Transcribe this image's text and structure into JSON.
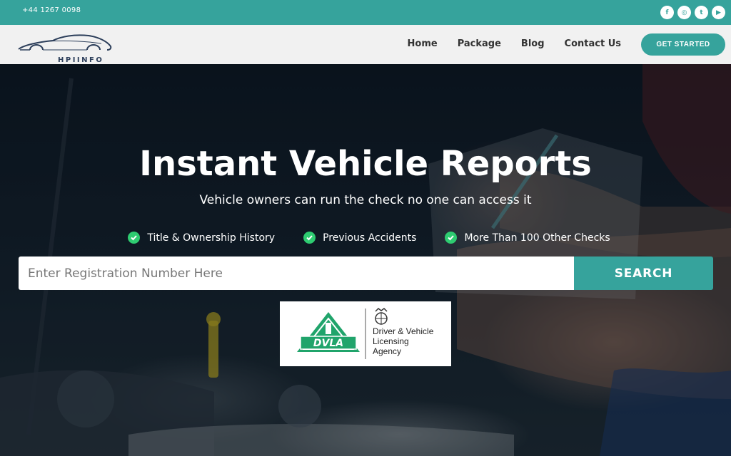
{
  "topbar": {
    "phone": "+44 1267 0098",
    "socials": [
      {
        "icon": "facebook-icon",
        "glyph": "f"
      },
      {
        "icon": "instagram-icon",
        "glyph": "◎"
      },
      {
        "icon": "twitter-icon",
        "glyph": "t"
      },
      {
        "icon": "youtube-icon",
        "glyph": "▶"
      }
    ]
  },
  "nav": {
    "logo_text": "HPIINFO",
    "links": [
      "Home",
      "Package",
      "Blog",
      "Contact Us"
    ],
    "cta_label": "GET STARTED"
  },
  "hero": {
    "title": "Instant Vehicle Reports",
    "subtitle": "Vehicle owners can run the check no one can access it",
    "features": [
      "Title & Ownership History",
      "Previous Accidents",
      "More Than 100 Other Checks"
    ],
    "search_placeholder": "Enter Registration Number Here",
    "search_label": "SEARCH",
    "dvla": {
      "badge_text": "DVLA",
      "agency_lines": [
        "Driver & Vehicle",
        "Licensing",
        "Agency"
      ]
    }
  },
  "colors": {
    "accent": "#36a39c",
    "check_green": "#2ecc71",
    "dvla_green": "#20a46b",
    "nav_bg": "#f1f1f1"
  }
}
